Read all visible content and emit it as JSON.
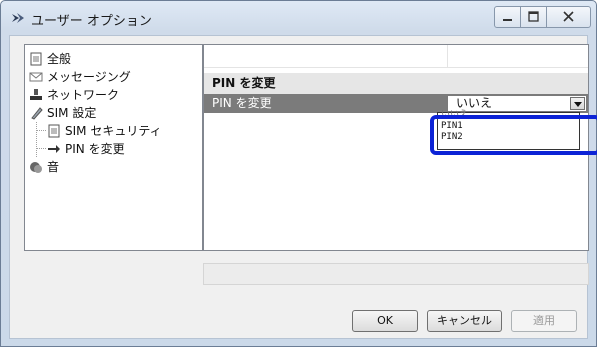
{
  "window": {
    "title": "ユーザー オプション",
    "controls": [
      "minimize",
      "maximize",
      "close"
    ]
  },
  "tree": {
    "items": [
      {
        "label": "全般",
        "icon": "document-icon",
        "level": 0
      },
      {
        "label": "メッセージング",
        "icon": "envelope-icon",
        "level": 0
      },
      {
        "label": "ネットワーク",
        "icon": "network-icon",
        "level": 0
      },
      {
        "label": "SIM 設定",
        "icon": "sim-icon",
        "level": 0
      },
      {
        "label": "SIM セキュリティ",
        "icon": "document-icon",
        "level": 1
      },
      {
        "label": "PIN を変更",
        "icon": "arrow-right-icon",
        "level": 1,
        "selected": true
      },
      {
        "label": "音",
        "icon": "sound-icon",
        "level": 0
      }
    ]
  },
  "panel": {
    "section_title": "PIN を変更",
    "property_label": "PIN を変更",
    "combo_value": "いいえ",
    "dropdown_options": [
      "いいえ",
      "PIN1",
      "PIN2"
    ]
  },
  "buttons": {
    "ok": "OK",
    "cancel": "キャンセル",
    "apply": "適用"
  },
  "colors": {
    "highlight": "#0c23d6",
    "selected_row": "#7b7b7b"
  }
}
